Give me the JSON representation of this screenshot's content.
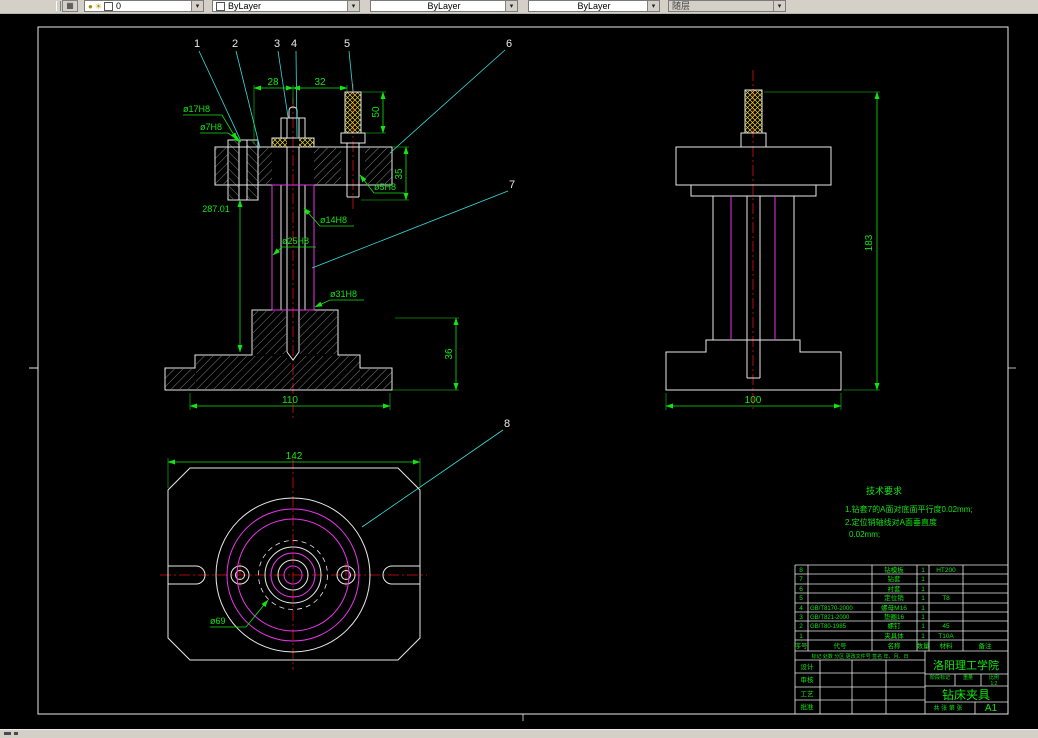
{
  "colors": {
    "canvas": "#000000",
    "line": "#e9e9e9",
    "magenta": "#e835e8",
    "red": "#e01010",
    "green": "#12e412",
    "yellow": "#e8d432",
    "cyan": "#35dede"
  },
  "toolbar": {
    "icons": {
      "layers": "▦",
      "bulb": "●",
      "sun": "☀",
      "dropdown": "▾"
    },
    "layer_name": "0",
    "color_combo_label": "ByLayer",
    "linetype_combo_label": "ByLayer",
    "lineweight_combo_label": "ByLayer",
    "plotstyle_combo_label": "随层"
  },
  "drawing": {
    "balloons": [
      "1",
      "2",
      "3",
      "4",
      "5",
      "6",
      "7",
      "8"
    ],
    "front": {
      "dim_28": "28",
      "dim_32": "32",
      "dim_50": "50",
      "dim_35": "35",
      "dim_36": "36",
      "dim_110": "110",
      "dim_total": "287.01",
      "callout_od": "ø17H8",
      "callout_hole": "ø7H8",
      "callout_pin": "ø5H8",
      "callout_bore14": "ø14H8",
      "callout_bore25": "ø25H8",
      "callout_bore31": "ø31H8"
    },
    "side": {
      "dim_183": "183",
      "dim_100": "100"
    },
    "top": {
      "dim_142": "142",
      "callout_69": "ø69"
    },
    "tech_requirements": {
      "title": "技术要求",
      "line1": "1.钻套7的A面对底面平行度0.02mm;",
      "line2": "2.定位销轴线对A面垂直度",
      "line3": "0.02mm;"
    }
  },
  "title_block": {
    "parts_header": {
      "no": "序号",
      "code": "代号",
      "name": "名称",
      "qty": "数量",
      "material": "材料",
      "notes": "备注"
    },
    "parts": [
      {
        "no": "8",
        "code": "",
        "name": "钻模板",
        "qty": "1",
        "material": "HT200"
      },
      {
        "no": "7",
        "code": "",
        "name": "钻套",
        "qty": "1",
        "material": ""
      },
      {
        "no": "6",
        "code": "",
        "name": "衬套",
        "qty": "1",
        "material": ""
      },
      {
        "no": "5",
        "code": "",
        "name": "定位销",
        "qty": "1",
        "material": "T8"
      },
      {
        "no": "4",
        "code": "GB/T8170-2000",
        "name": "螺母M16",
        "qty": "1",
        "material": ""
      },
      {
        "no": "3",
        "code": "GB/T821-2000",
        "name": "垫圈16",
        "qty": "1",
        "material": ""
      },
      {
        "no": "2",
        "code": "GB/T80-1985",
        "name": "螺钉",
        "qty": "1",
        "material": "45"
      },
      {
        "no": "1",
        "code": "",
        "name": "夹具体",
        "qty": "1",
        "material": "T10A"
      }
    ],
    "revision_header": "标记 处数 分区 更改文件号 签名 年、月、日",
    "sign_rows": [
      "设计",
      "审核",
      "工艺",
      "批准"
    ],
    "school": "洛阳理工学院",
    "stage_label": "阶段标记",
    "weight_label": "重量",
    "scale_label": "比例",
    "scale_value": "1:2",
    "title": "钻床夹具",
    "sheet_note": "共 张 第 张",
    "sheet_size": "A1"
  }
}
